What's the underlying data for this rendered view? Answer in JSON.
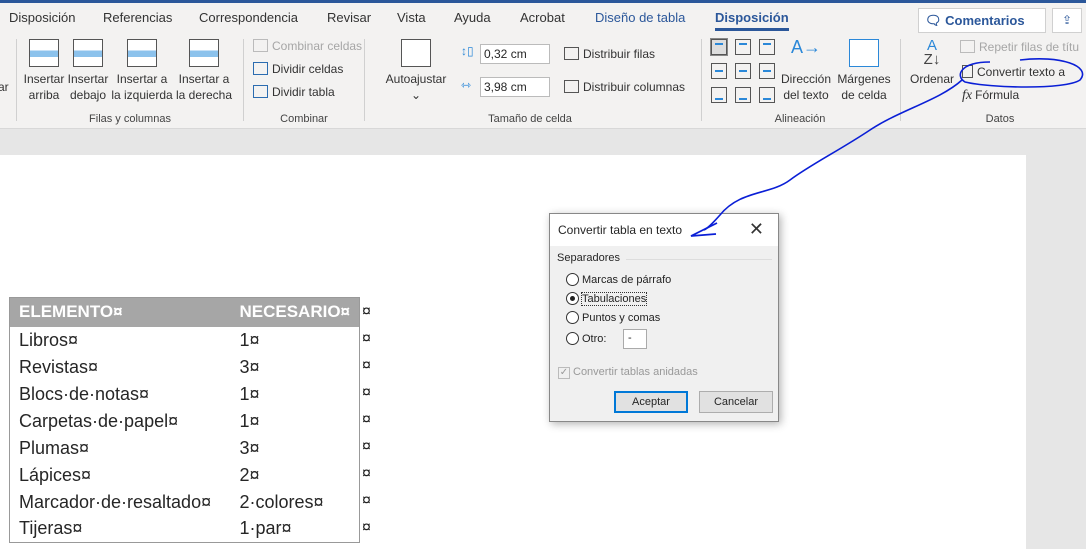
{
  "tabs": [
    "Disposición",
    "Referencias",
    "Correspondencia",
    "Revisar",
    "Vista",
    "Ayuda",
    "Acrobat",
    "Diseño de tabla",
    "Disposición"
  ],
  "comments_label": "Comentarios",
  "ribbon": {
    "rows_cols": {
      "partial": "ar",
      "insert_above": [
        "Insertar",
        "arriba"
      ],
      "insert_below": [
        "Insertar",
        "debajo"
      ],
      "insert_left": [
        "Insertar a",
        "la izquierda"
      ],
      "insert_right": [
        "Insertar a",
        "la derecha"
      ],
      "label": "Filas y columnas"
    },
    "merge": {
      "merge_cells": "Combinar celdas",
      "split_cells": "Dividir celdas",
      "split_table": "Dividir tabla",
      "label": "Combinar"
    },
    "cell_size": {
      "autofit": "Autoajustar",
      "height": "0,32 cm",
      "width": "3,98 cm",
      "distribute_rows": "Distribuir filas",
      "distribute_cols": "Distribuir columnas",
      "label": "Tamaño de celda"
    },
    "alignment": {
      "text_direction": [
        "Dirección",
        "del texto"
      ],
      "cell_margins": [
        "Márgenes",
        "de celda"
      ],
      "label": "Alineación"
    },
    "data": {
      "sort": "Ordenar",
      "repeat_header": "Repetir filas de títu",
      "convert": "Convertir texto a",
      "formula": "Fórmula",
      "label": "Datos"
    }
  },
  "table": {
    "header": [
      "ELEMENTO¤",
      "NECESARIO¤"
    ],
    "rows": [
      [
        "Libros¤",
        "1¤"
      ],
      [
        "Revistas¤",
        "3¤"
      ],
      [
        "Blocs·de·notas¤",
        "1¤"
      ],
      [
        "Carpetas·de·papel¤",
        "1¤"
      ],
      [
        "Plumas¤",
        "3¤"
      ],
      [
        "Lápices¤",
        "2¤"
      ],
      [
        "Marcador·de·resaltado¤",
        "2·colores¤"
      ],
      [
        "Tijeras¤",
        "1·par¤"
      ]
    ],
    "row_end_mark": "¤"
  },
  "dialog": {
    "title": "Convertir tabla en texto",
    "group": "Separadores",
    "options": [
      "Marcas de párrafo",
      "Tabulaciones",
      "Puntos y comas",
      "Otro:"
    ],
    "selected": "Tabulaciones",
    "other_value": "-",
    "nested": "Convertir tablas anidadas",
    "nested_checked": true,
    "ok": "Aceptar",
    "cancel": "Cancelar"
  },
  "annotation_color": "#0a1fd6"
}
